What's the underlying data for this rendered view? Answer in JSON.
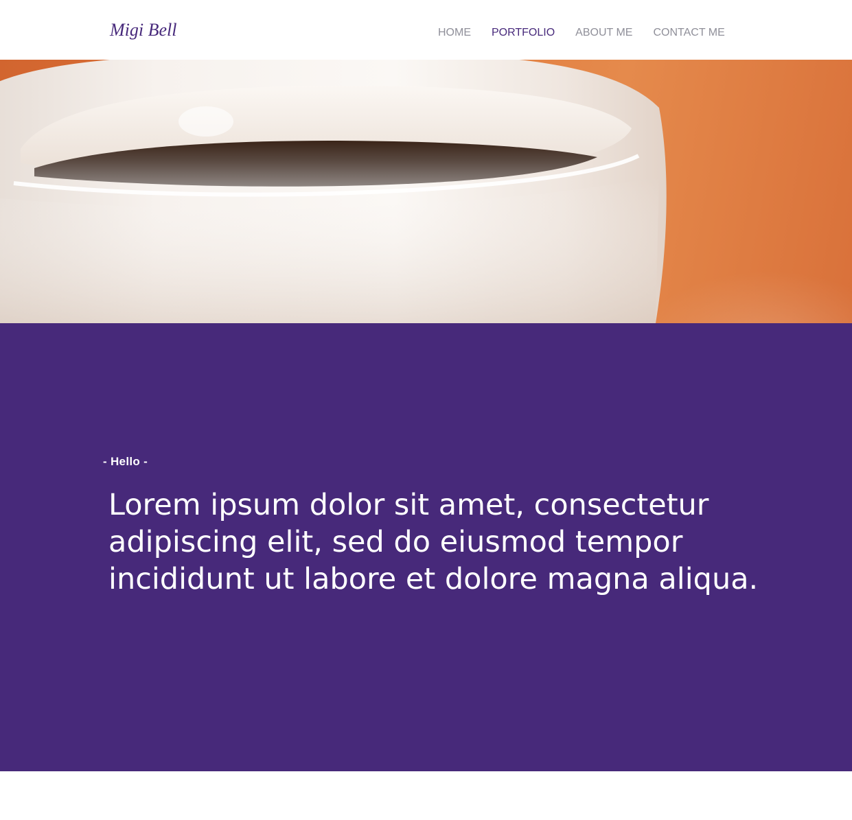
{
  "header": {
    "logo": "Migi Bell",
    "nav": [
      {
        "label": "HOME",
        "active": false
      },
      {
        "label": "PORTFOLIO",
        "active": true
      },
      {
        "label": "ABOUT ME",
        "active": false
      },
      {
        "label": "CONTACT ME",
        "active": false
      }
    ]
  },
  "hero": {
    "image": "coffee-cup-photo"
  },
  "intro": {
    "eyebrow": "- Hello -",
    "text": "Lorem ipsum dolor sit amet, consectetur adipiscing elit, sed do eiusmod tempor incididunt ut labore et dolore magna aliqua."
  },
  "colors": {
    "brand_purple": "#47297a",
    "nav_inactive": "#8f8f99",
    "background": "#ffffff"
  }
}
